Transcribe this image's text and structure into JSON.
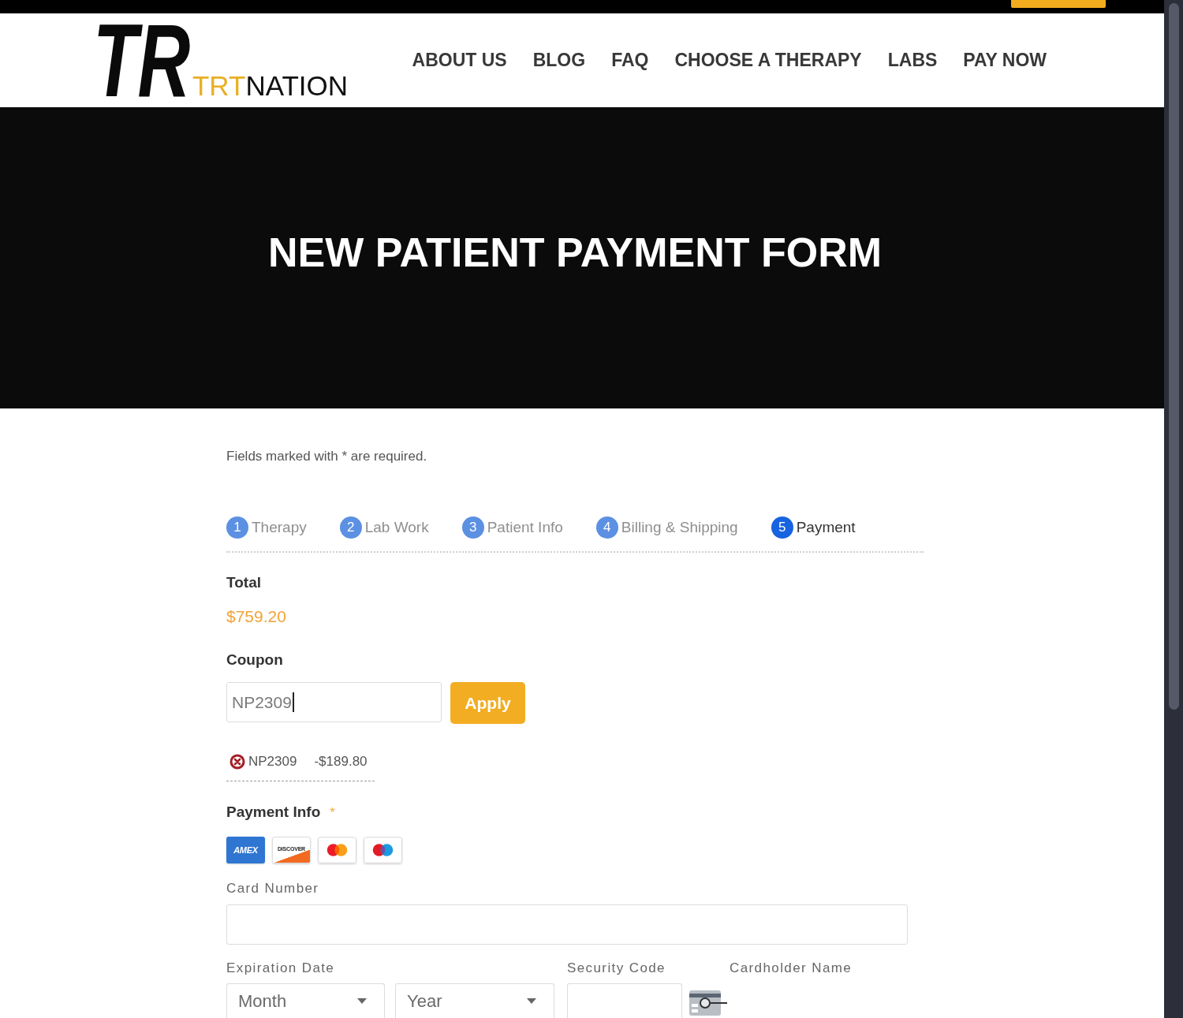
{
  "logo": {
    "mark": "TR",
    "name_accent": "TRT",
    "name_rest": "NATION"
  },
  "nav_items": [
    "ABOUT US",
    "BLOG",
    "FAQ",
    "CHOOSE A THERAPY",
    "LABS",
    "PAY NOW"
  ],
  "hero": {
    "title": "NEW PATIENT PAYMENT FORM"
  },
  "form": {
    "required_note": "Fields marked with * are required.",
    "steps": [
      {
        "number": "1",
        "label": "Therapy",
        "selected": false
      },
      {
        "number": "2",
        "label": "Lab Work",
        "selected": false
      },
      {
        "number": "3",
        "label": "Patient Info",
        "selected": false
      },
      {
        "number": "4",
        "label": "Billing & Shipping",
        "selected": false
      },
      {
        "number": "5",
        "label": "Payment",
        "selected": true
      }
    ],
    "total": {
      "label": "Total",
      "amount": "$759.20"
    },
    "coupon": {
      "label": "Coupon",
      "value": "NP2309",
      "focused": true,
      "button": "Apply",
      "applied": [
        {
          "code": "NP2309",
          "discount": "-$189.80"
        }
      ]
    },
    "payment_info": {
      "label": "Payment Info",
      "required_mark": "*",
      "cards": [
        {
          "kind": "amex",
          "label": "AMEX"
        },
        {
          "kind": "discover",
          "label": "DISCOVER"
        },
        {
          "kind": "mastercard"
        },
        {
          "kind": "maestro"
        }
      ],
      "card_number": {
        "label": "Card Number"
      },
      "expiration": {
        "label": "Expiration Date",
        "month": {
          "placeholder": "Month"
        },
        "year": {
          "placeholder": "Year"
        }
      },
      "security_code": {
        "label": "Security Code"
      },
      "cardholder_name": {
        "label": "Cardholder Name"
      }
    }
  }
}
